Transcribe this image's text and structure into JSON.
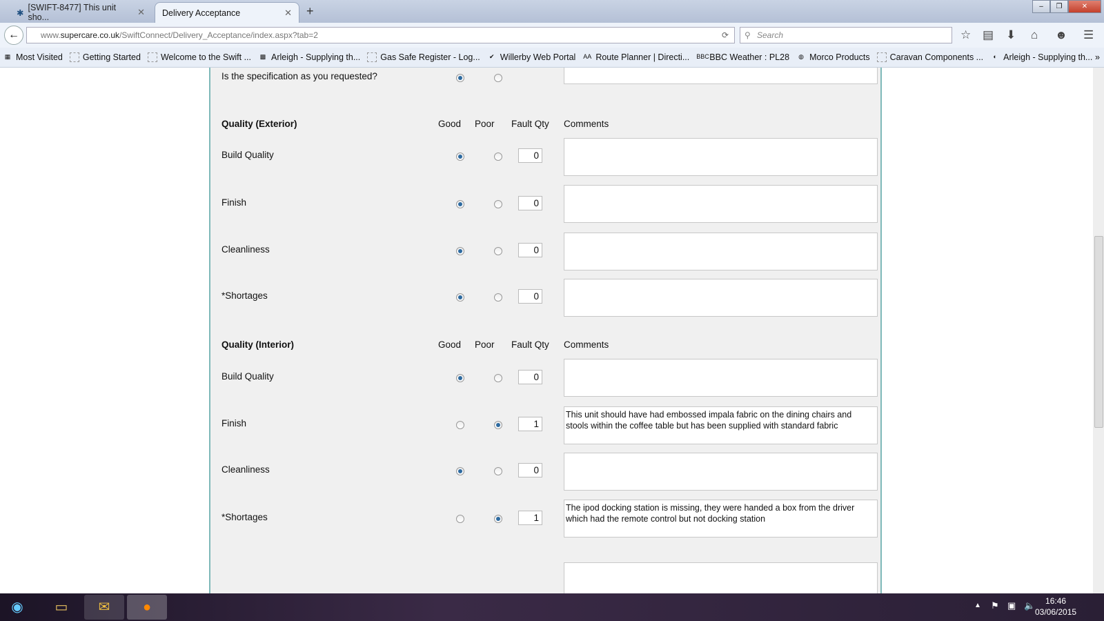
{
  "browser": {
    "tabs": [
      {
        "label": "[SWIFT-8477] This unit sho...",
        "icon": "jira-icon"
      },
      {
        "label": "Delivery Acceptance"
      }
    ],
    "url_domain": "www.supercare.co.uk",
    "url_host": "supercare.co.uk",
    "url_prefix": "www.",
    "url_path": "/SwiftConnect/Delivery_Acceptance/index.aspx?tab=2",
    "search_placeholder": "Search",
    "bookmarks": [
      "Most Visited",
      "Getting Started",
      "Welcome to the Swift ...",
      "Arleigh - Supplying th...",
      "Gas Safe Register - Log...",
      "Willerby Web Portal",
      "Route Planner | Directi...",
      "BBC Weather : PL28",
      "Morco Products",
      "Caravan Components ...",
      "Arleigh - Supplying th..."
    ]
  },
  "form": {
    "spec_question": "Is the specification as you requested?",
    "spec_answer": "good",
    "columns": {
      "good": "Good",
      "poor": "Poor",
      "qty": "Fault Qty",
      "comments": "Comments"
    },
    "sections": [
      {
        "title": "Quality (Exterior)",
        "rows": [
          {
            "label": "Build Quality",
            "value": "good",
            "qty": "0",
            "comment": ""
          },
          {
            "label": "Finish",
            "value": "good",
            "qty": "0",
            "comment": ""
          },
          {
            "label": "Cleanliness",
            "value": "good",
            "qty": "0",
            "comment": ""
          },
          {
            "label": "*Shortages",
            "value": "good",
            "qty": "0",
            "comment": ""
          }
        ]
      },
      {
        "title": "Quality (Interior)",
        "rows": [
          {
            "label": "Build Quality",
            "value": "good",
            "qty": "0",
            "comment": ""
          },
          {
            "label": "Finish",
            "value": "poor",
            "qty": "1",
            "comment": "This unit should have had embossed impala fabric on the dining chairs and stools within the coffee table but has been supplied with standard fabric"
          },
          {
            "label": "Cleanliness",
            "value": "good",
            "qty": "0",
            "comment": ""
          },
          {
            "label": "*Shortages",
            "value": "poor",
            "qty": "1",
            "comment": "The ipod  docking station is missing, they were handed a box from the driver which had the remote control but not docking station"
          }
        ]
      }
    ]
  },
  "taskbar": {
    "time": "16:46",
    "date": "03/06/2015"
  },
  "colors": {
    "radio_selected": "#2d6aa0",
    "panel_border": "#7fb9b9"
  }
}
